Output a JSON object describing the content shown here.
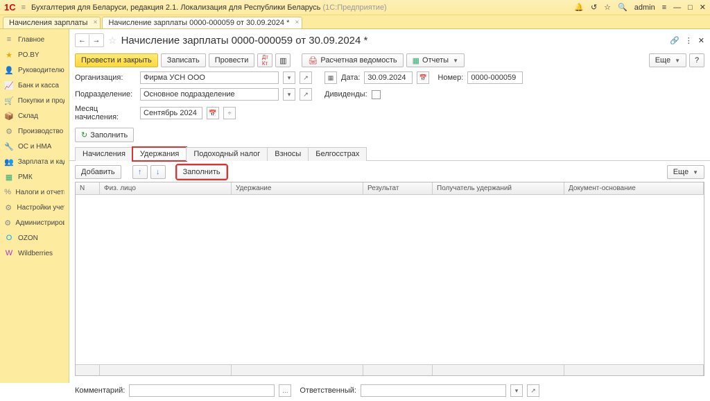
{
  "app": {
    "logo": "1C",
    "title": "Бухгалтерия для Беларуси, редакция 2.1. Локализация для Республики Беларусь",
    "suffix": "(1С:Предприятие)",
    "user": "admin"
  },
  "apptabs": [
    {
      "label": "Начисления зарплаты"
    },
    {
      "label": "Начисление зарплаты 0000-000059 от 30.09.2024 *"
    }
  ],
  "sidebar": [
    {
      "icon": "≡",
      "label": "Главное",
      "color": "#888"
    },
    {
      "icon": "★",
      "label": "PO.BY",
      "color": "#e3b000"
    },
    {
      "icon": "👤",
      "label": "Руководителю",
      "color": "#888"
    },
    {
      "icon": "📈",
      "label": "Банк и касса",
      "color": "#4a9"
    },
    {
      "icon": "🛒",
      "label": "Покупки и продажи",
      "color": "#888"
    },
    {
      "icon": "📦",
      "label": "Склад",
      "color": "#b88"
    },
    {
      "icon": "⚙",
      "label": "Производство",
      "color": "#888"
    },
    {
      "icon": "🔧",
      "label": "ОС и НМА",
      "color": "#888"
    },
    {
      "icon": "👥",
      "label": "Зарплата и кадры",
      "color": "#888"
    },
    {
      "icon": "▦",
      "label": "РМК",
      "color": "#3a7"
    },
    {
      "icon": "%",
      "label": "Налоги и отчетность",
      "color": "#888"
    },
    {
      "icon": "⚙",
      "label": "Настройки учета",
      "color": "#888"
    },
    {
      "icon": "⚙",
      "label": "Администрирование",
      "color": "#888"
    },
    {
      "icon": "O",
      "label": "OZON",
      "color": "#0af"
    },
    {
      "icon": "W",
      "label": "Wildberries",
      "color": "#a3c"
    }
  ],
  "doc": {
    "title": "Начисление зарплаты 0000-000059 от 30.09.2024 *",
    "toolbar": {
      "post_close": "Провести и закрыть",
      "save": "Записать",
      "post": "Провести",
      "payroll": "Расчетная ведомость",
      "reports": "Отчеты"
    },
    "more": "Еще",
    "fields": {
      "org_label": "Организация:",
      "org_value": "Фирма УСН ООО",
      "date_label": "Дата:",
      "date_value": "30.09.2024",
      "num_label": "Номер:",
      "num_value": "0000-000059",
      "dept_label": "Подразделение:",
      "dept_value": "Основное подразделение",
      "div_label": "Дивиденды:",
      "month_label": "Месяц начисления:",
      "month_value": "Сентябрь 2024"
    },
    "fill": "Заполнить",
    "tabs": [
      "Начисления",
      "Удержания",
      "Подоходный налог",
      "Взносы",
      "Белгосстрах"
    ],
    "tabbody": {
      "add": "Добавить",
      "fill2": "Заполнить",
      "more2": "Еще",
      "cols": [
        "N",
        "Физ. лицо",
        "Удержание",
        "Результат",
        "Получатель удержаний",
        "Документ-основание"
      ]
    },
    "bottom": {
      "comment_label": "Комментарий:",
      "resp_label": "Ответственный:"
    }
  }
}
